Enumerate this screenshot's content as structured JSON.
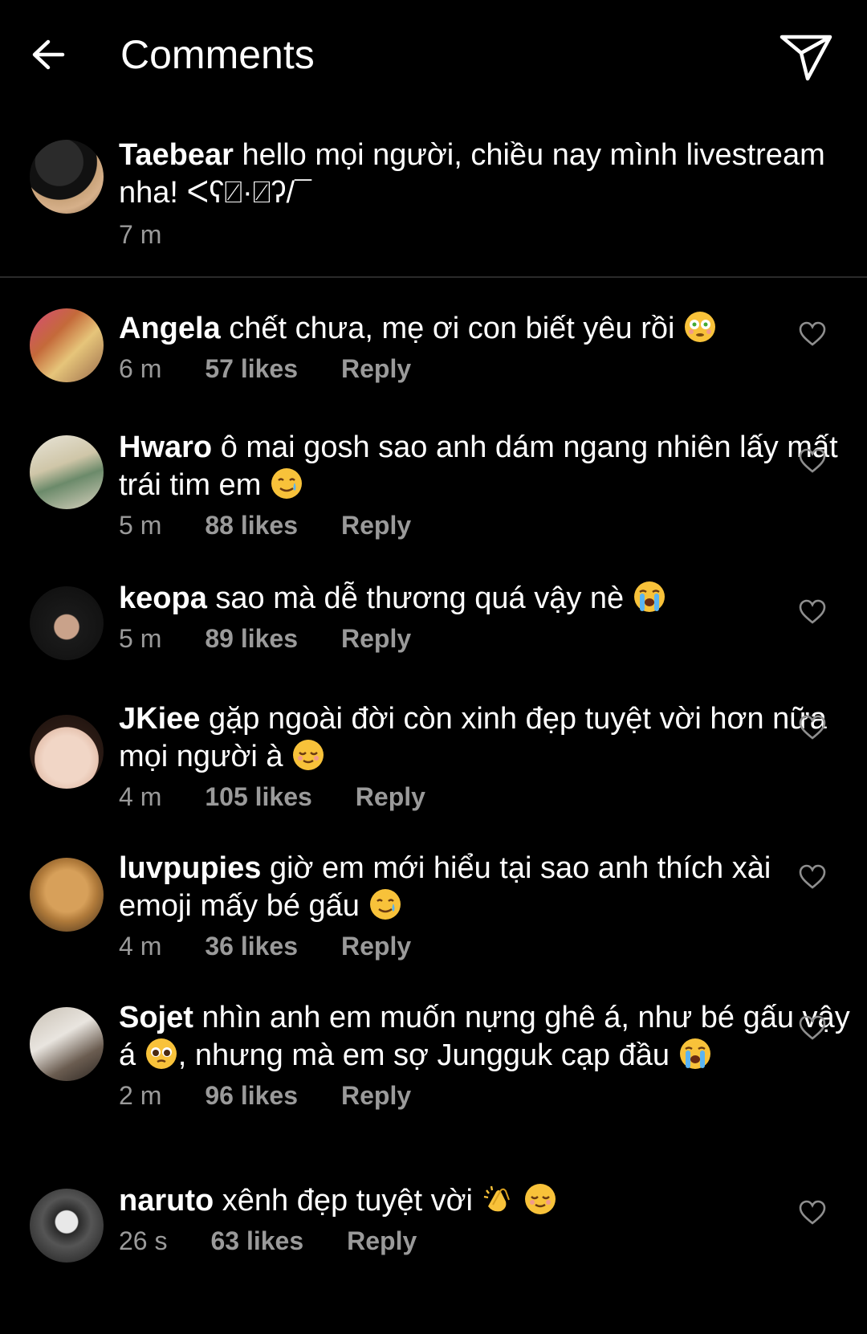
{
  "header": {
    "title": "Comments",
    "back_icon": "arrow-left-icon",
    "send_icon": "paper-plane-icon"
  },
  "caption": {
    "username": "Taebear",
    "text": "hello mọi người, chiều nay mình livestream nha! ᐸʕ⍁·⍁ʔ/¯",
    "time": "7 m"
  },
  "comments": [
    {
      "username": "Angela",
      "text": "chết chưa, mẹ ơi con biết yêu rồi",
      "emojis": [
        "flushed"
      ],
      "time": "6 m",
      "likes": "57 likes",
      "reply": "Reply"
    },
    {
      "username": "Hwaro",
      "text": "ô mai gosh sao anh dám ngang nhiên lấy mất trái tim em",
      "emojis": [
        "tear-smile"
      ],
      "time": "5 m",
      "likes": "88 likes",
      "reply": "Reply"
    },
    {
      "username": "keopa",
      "text": "sao mà dễ thương quá vậy nè",
      "emojis": [
        "loudly-crying"
      ],
      "time": "5 m",
      "likes": "89 likes",
      "reply": "Reply"
    },
    {
      "username": "JKiee",
      "text": "gặp ngoài đời còn xinh đẹp tuyệt vời hơn nữa mọi người à",
      "emojis": [
        "relieved"
      ],
      "time": "4 m",
      "likes": "105 likes",
      "reply": "Reply"
    },
    {
      "username": "luvpupies",
      "text": "giờ em mới hiểu tại sao anh thích xài emoji mấy bé gấu",
      "emojis": [
        "tear-smile"
      ],
      "time": "4 m",
      "likes": "36 likes",
      "reply": "Reply"
    },
    {
      "username": "Sojet",
      "text_parts": [
        "nhìn anh em muốn nựng ghê á, như bé gấu vậy á",
        ", nhưng mà em sợ Jungguk cạp đầu"
      ],
      "emojis": [
        "pleading",
        "loudly-crying"
      ],
      "time": "2 m",
      "likes": "96 likes",
      "reply": "Reply"
    },
    {
      "username": "naruto",
      "text": "xênh đẹp tuyệt vời",
      "emojis": [
        "clapping",
        "relieved"
      ],
      "time": "26 s",
      "likes": "63 likes",
      "reply": "Reply"
    }
  ]
}
